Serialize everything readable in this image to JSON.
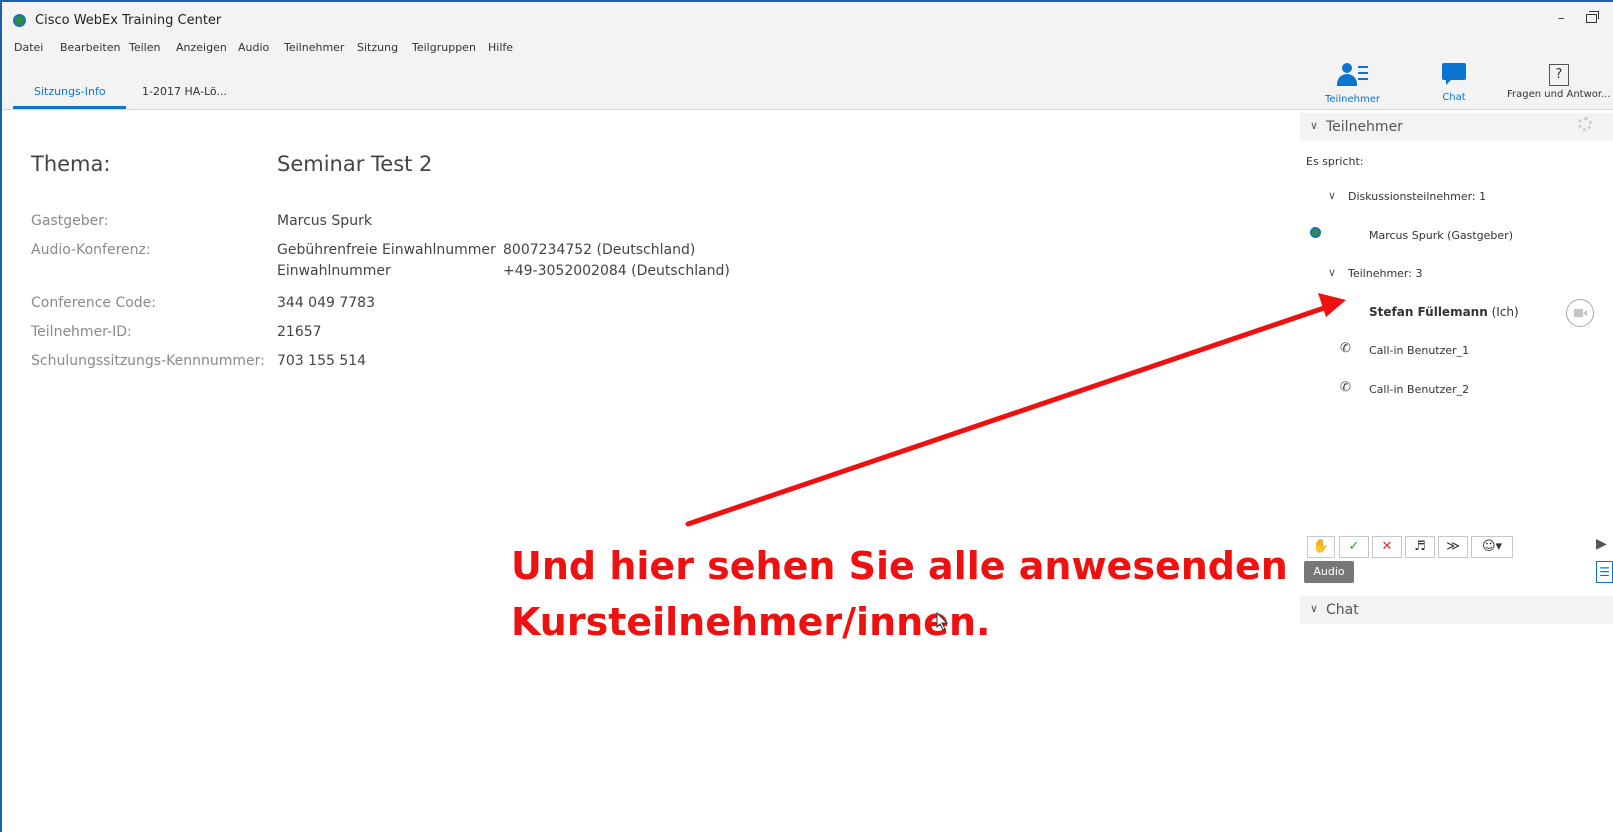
{
  "window": {
    "title": "Cisco WebEx Training Center",
    "minimize_glyph": "–"
  },
  "menubar": [
    "Datei",
    "Bearbeiten",
    "Teilen",
    "Anzeigen",
    "Audio",
    "Teilnehmer",
    "Sitzung",
    "Teilgruppen",
    "Hilfe"
  ],
  "tabs": [
    {
      "label": "Sitzungs-Info",
      "active": true
    },
    {
      "label": "1-2017 HA-Lö...",
      "active": false
    }
  ],
  "session_info": {
    "topic_label": "Thema:",
    "topic_value": "Seminar Test 2",
    "host_label": "Gastgeber:",
    "host_value": "Marcus Spurk",
    "audio_label": "Audio-Konferenz:",
    "tollfree_label": "Gebührenfreie Einwahlnummer",
    "tollfree_number": "8007234752  (Deutschland)",
    "dialin_label": "Einwahlnummer",
    "dialin_number": "+49-3052002084  (Deutschland)",
    "conference_code_label": "Conference Code:",
    "conference_code_value": "344 049 7783",
    "participant_id_label": "Teilnehmer-ID:",
    "participant_id_value": "21657",
    "session_number_label": "Schulungssitzungs-Kennnummer:",
    "session_number_value": "703 155 514"
  },
  "right_panel": {
    "toolbar": {
      "participants_label": "Teilnehmer",
      "chat_label": "Chat",
      "qa_label": "Fragen und Antwor...",
      "qa_glyph": "?"
    },
    "participants_header": "Teilnehmer",
    "speaking_label": "Es spricht:",
    "panelists_group": "Diskussionsteilnehmer: 1",
    "host_name": "Marcus Spurk (Gastgeber)",
    "attendees_group": "Teilnehmer: 3",
    "me_name": "Stefan Füllemann",
    "me_suffix": "(Ich)",
    "callin_1": "Call-in Benutzer_1",
    "callin_2": "Call-in Benutzer_2",
    "audio_badge": "Audio",
    "chat_header": "Chat"
  },
  "annotation": {
    "line1": "Und hier sehen Sie alle anwesenden",
    "line2": "Kursteilnehmer/innen.",
    "color": "#ee1111"
  },
  "colors": {
    "accent": "#0b74d0",
    "toolbar_bg": "#f3f3f3"
  }
}
